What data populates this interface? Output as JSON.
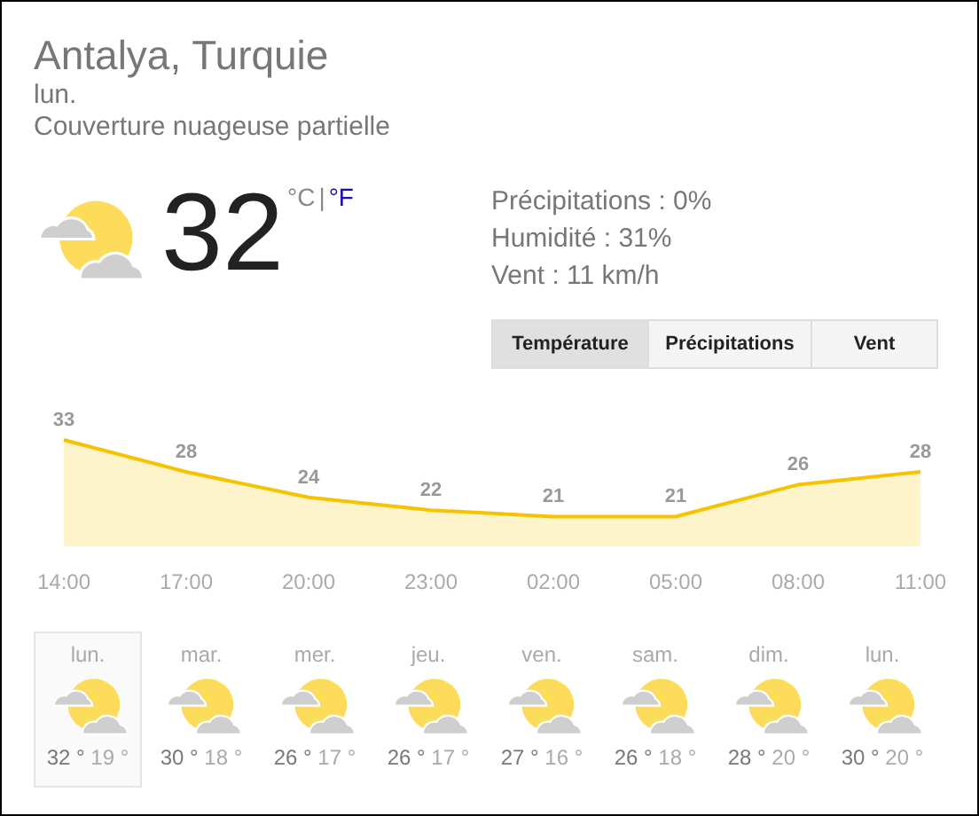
{
  "location": "Antalya, Turquie",
  "day": "lun.",
  "condition": "Couverture nuageuse partielle",
  "current": {
    "temperature": "32",
    "units": [
      {
        "label": "°C",
        "selected": true
      },
      {
        "label": "°F",
        "selected": false
      }
    ],
    "unit_separator": "|"
  },
  "details": [
    "Précipitations : 0%",
    "Humidité : 31%",
    "Vent : 11 km/h"
  ],
  "tabs": [
    {
      "label": "Température",
      "selected": true
    },
    {
      "label": "Précipitations",
      "selected": false
    },
    {
      "label": "Vent",
      "selected": false
    }
  ],
  "chart_data": {
    "type": "area",
    "x": [
      "14:00",
      "17:00",
      "20:00",
      "23:00",
      "02:00",
      "05:00",
      "08:00",
      "11:00"
    ],
    "values": [
      33,
      28,
      24,
      22,
      21,
      21,
      26,
      28
    ],
    "data_labels": true
  },
  "forecast": [
    {
      "day": "lun.",
      "high": "32 °",
      "low": "19 °",
      "selected": true
    },
    {
      "day": "mar.",
      "high": "30 °",
      "low": "18 °",
      "selected": false
    },
    {
      "day": "mer.",
      "high": "26 °",
      "low": "17 °",
      "selected": false
    },
    {
      "day": "jeu.",
      "high": "26 °",
      "low": "17 °",
      "selected": false
    },
    {
      "day": "ven.",
      "high": "27 °",
      "low": "16 °",
      "selected": false
    },
    {
      "day": "sam.",
      "high": "26 °",
      "low": "18 °",
      "selected": false
    },
    {
      "day": "dim.",
      "high": "28 °",
      "low": "20 °",
      "selected": false
    },
    {
      "day": "lun.",
      "high": "30 °",
      "low": "20 °",
      "selected": false
    }
  ]
}
